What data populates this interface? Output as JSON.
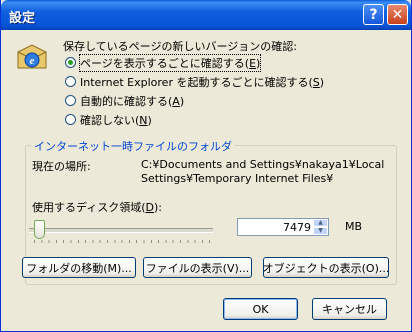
{
  "window": {
    "title": "設定",
    "help_glyph": "?",
    "close_glyph": "✕"
  },
  "check": {
    "heading": "保存しているページの新しいバージョンの確認:",
    "selected": 0,
    "options": [
      {
        "text": "ページを表示するごとに確認する(",
        "key": "E",
        "tail": ")"
      },
      {
        "text": "Internet Explorer を起動するごとに確認する(",
        "key": "S",
        "tail": ")"
      },
      {
        "text": "自動的に確認する(",
        "key": "A",
        "tail": ")"
      },
      {
        "text": "確認しない(",
        "key": "N",
        "tail": ")"
      }
    ]
  },
  "temp": {
    "group_label": "インターネット一時ファイルのフォルダ",
    "location_label": "現在の場所:",
    "location_line1": "C:¥Documents and Settings¥nakaya1¥Local",
    "location_line2": "Settings¥Temporary Internet Files¥",
    "disk_label_pre": "使用するディスク領域(",
    "disk_label_key": "D",
    "disk_label_post": "):",
    "disk_value": "7479",
    "disk_unit": "MB",
    "slider_fraction": 0.03,
    "buttons": [
      "フォルダの移動(M)...",
      "ファイルの表示(V)...",
      "オブジェクトの表示(O)..."
    ]
  },
  "footer": {
    "ok": "OK",
    "cancel": "キャンセル"
  },
  "icons": {
    "app": "internet-explorer-icon"
  }
}
